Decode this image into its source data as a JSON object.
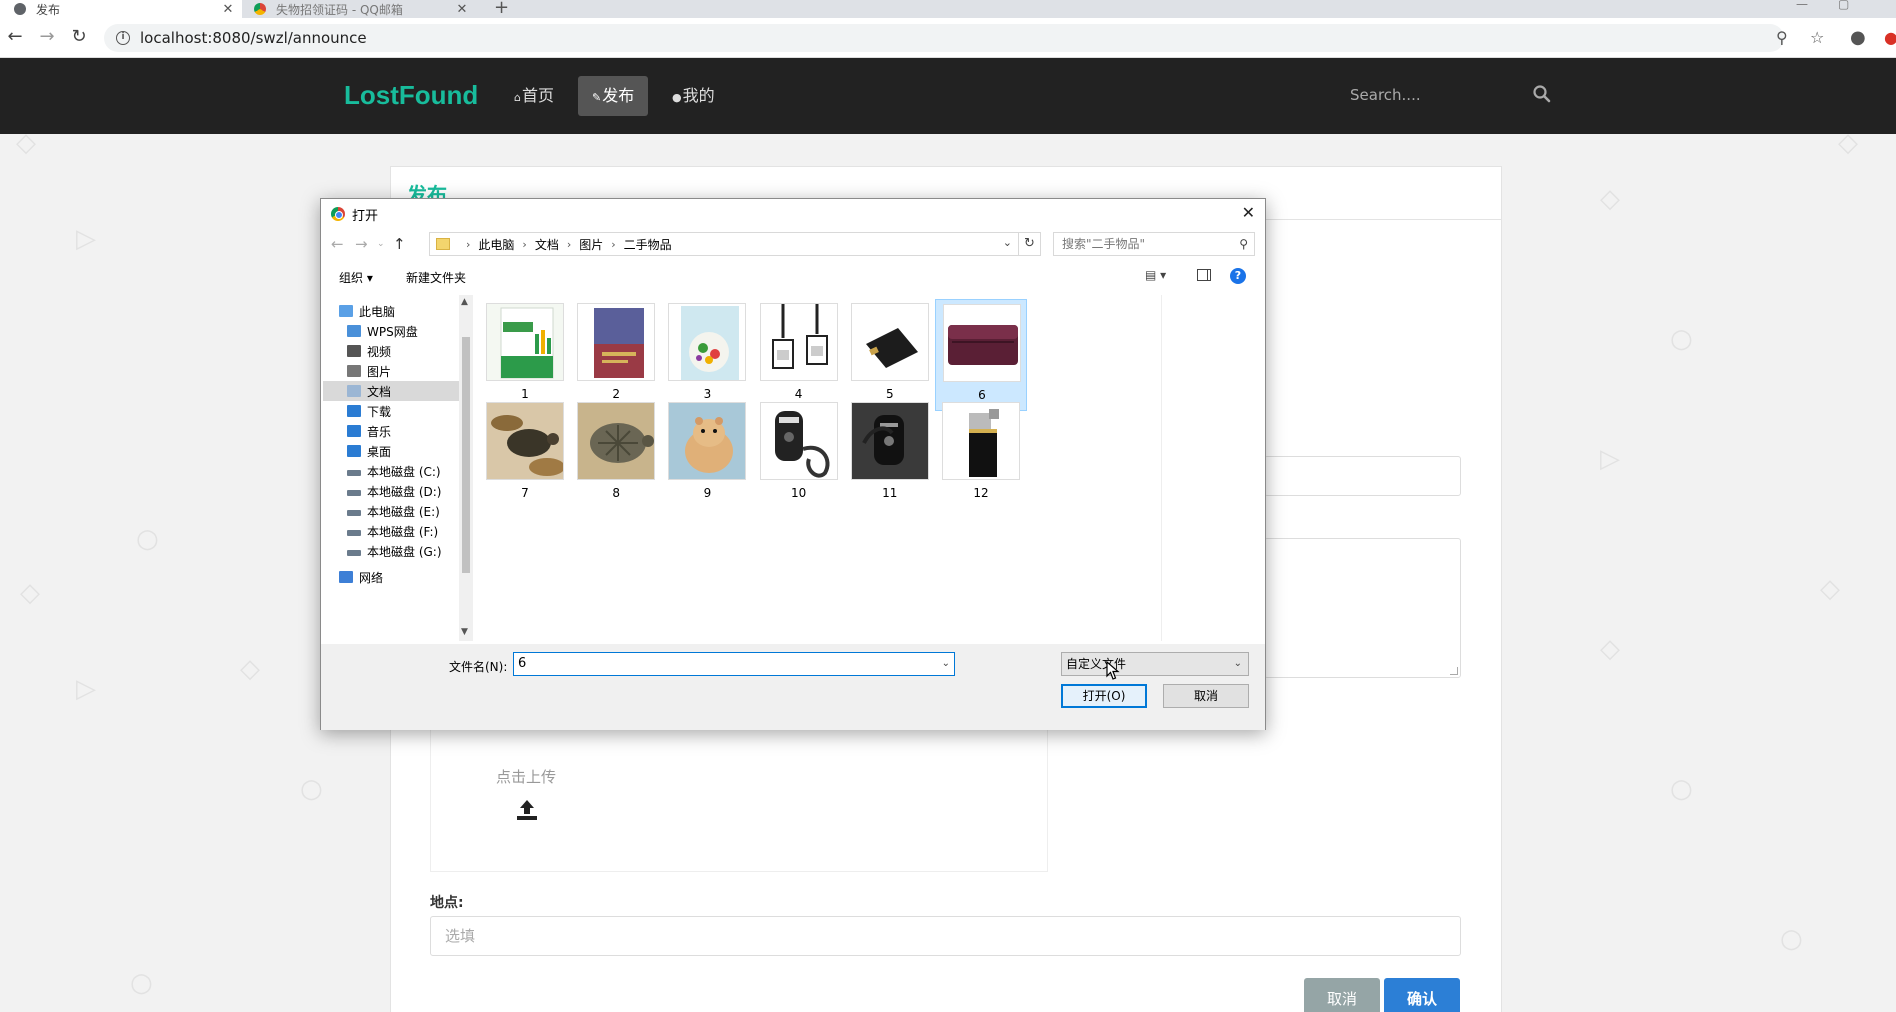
{
  "browser": {
    "tabs": [
      {
        "title": "发布",
        "active": true
      },
      {
        "title": "失物招领证码 - QQ邮箱",
        "active": false
      }
    ],
    "new_tab": "+",
    "url": "localhost:8080/swzl/announce"
  },
  "navbar": {
    "brand": "LostFound",
    "items": [
      {
        "icon": "home-icon",
        "label": "首页",
        "active": false
      },
      {
        "icon": "edit-icon",
        "label": "发布",
        "active": true
      },
      {
        "icon": "user-icon",
        "label": "我的",
        "active": false
      }
    ],
    "search_placeholder": "Search...."
  },
  "form": {
    "panel_title": "发布",
    "upload_label": "点击上传",
    "location_label": "地点:",
    "location_placeholder": "选填",
    "cancel_label": "取消",
    "confirm_label": "确认"
  },
  "dialog": {
    "title": "打开",
    "close": "✕",
    "breadcrumb": [
      "此电脑",
      "文档",
      "图片",
      "二手物品"
    ],
    "search_placeholder": "搜索\"二手物品\"",
    "organize": "组织 ▾",
    "new_folder": "新建文件夹",
    "help": "?",
    "nav_items": [
      {
        "label": "此电脑",
        "icon": "computer-icon",
        "color": "#5aa0e6",
        "selected": false
      },
      {
        "label": "WPS网盘",
        "icon": "cloud-icon",
        "color": "#4a90d9",
        "selected": false
      },
      {
        "label": "视频",
        "icon": "video-icon",
        "color": "#555555",
        "selected": false
      },
      {
        "label": "图片",
        "icon": "pictures-icon",
        "color": "#777777",
        "selected": false
      },
      {
        "label": "文档",
        "icon": "documents-icon",
        "color": "#9bb6d4",
        "selected": true
      },
      {
        "label": "下载",
        "icon": "download-icon",
        "color": "#2b7cd3",
        "selected": false
      },
      {
        "label": "音乐",
        "icon": "music-icon",
        "color": "#2b7cd3",
        "selected": false
      },
      {
        "label": "桌面",
        "icon": "desktop-icon",
        "color": "#2b7cd3",
        "selected": false
      },
      {
        "label": "本地磁盘 (C:)",
        "icon": "drive-icon",
        "color": "#6a7b8c",
        "selected": false
      },
      {
        "label": "本地磁盘 (D:)",
        "icon": "drive-icon",
        "color": "#6a7b8c",
        "selected": false
      },
      {
        "label": "本地磁盘 (E:)",
        "icon": "drive-icon",
        "color": "#6a7b8c",
        "selected": false
      },
      {
        "label": "本地磁盘 (F:)",
        "icon": "drive-icon",
        "color": "#6a7b8c",
        "selected": false
      },
      {
        "label": "本地磁盘 (G:)",
        "icon": "drive-icon",
        "color": "#6a7b8c",
        "selected": false
      },
      {
        "label": "网络",
        "icon": "network-icon",
        "color": "#3d7fd6",
        "selected": false
      }
    ],
    "files": [
      {
        "name": "1",
        "thumb": "excel-book-thumb",
        "selected": false
      },
      {
        "name": "2",
        "thumb": "red-book-thumb",
        "selected": false
      },
      {
        "name": "3",
        "thumb": "recipe-book-thumb",
        "selected": false
      },
      {
        "name": "4",
        "thumb": "id-badges-thumb",
        "selected": false
      },
      {
        "name": "5",
        "thumb": "black-card-holder-thumb",
        "selected": false
      },
      {
        "name": "6",
        "thumb": "purple-wallet-thumb",
        "selected": true
      },
      {
        "name": "7",
        "thumb": "turtle-on-leaves-thumb",
        "selected": false
      },
      {
        "name": "8",
        "thumb": "turtle-thumb",
        "selected": false
      },
      {
        "name": "9",
        "thumb": "hamster-thumb",
        "selected": false
      },
      {
        "name": "10",
        "thumb": "car-key-thumb",
        "selected": false
      },
      {
        "name": "11",
        "thumb": "car-key-dark-thumb",
        "selected": false
      },
      {
        "name": "12",
        "thumb": "lighter-thumb",
        "selected": false
      }
    ],
    "filename_label": "文件名(N):",
    "filename_value": "6",
    "filetype_value": "自定义文件",
    "open_label": "打开(O)",
    "cancel_label": "取消"
  }
}
